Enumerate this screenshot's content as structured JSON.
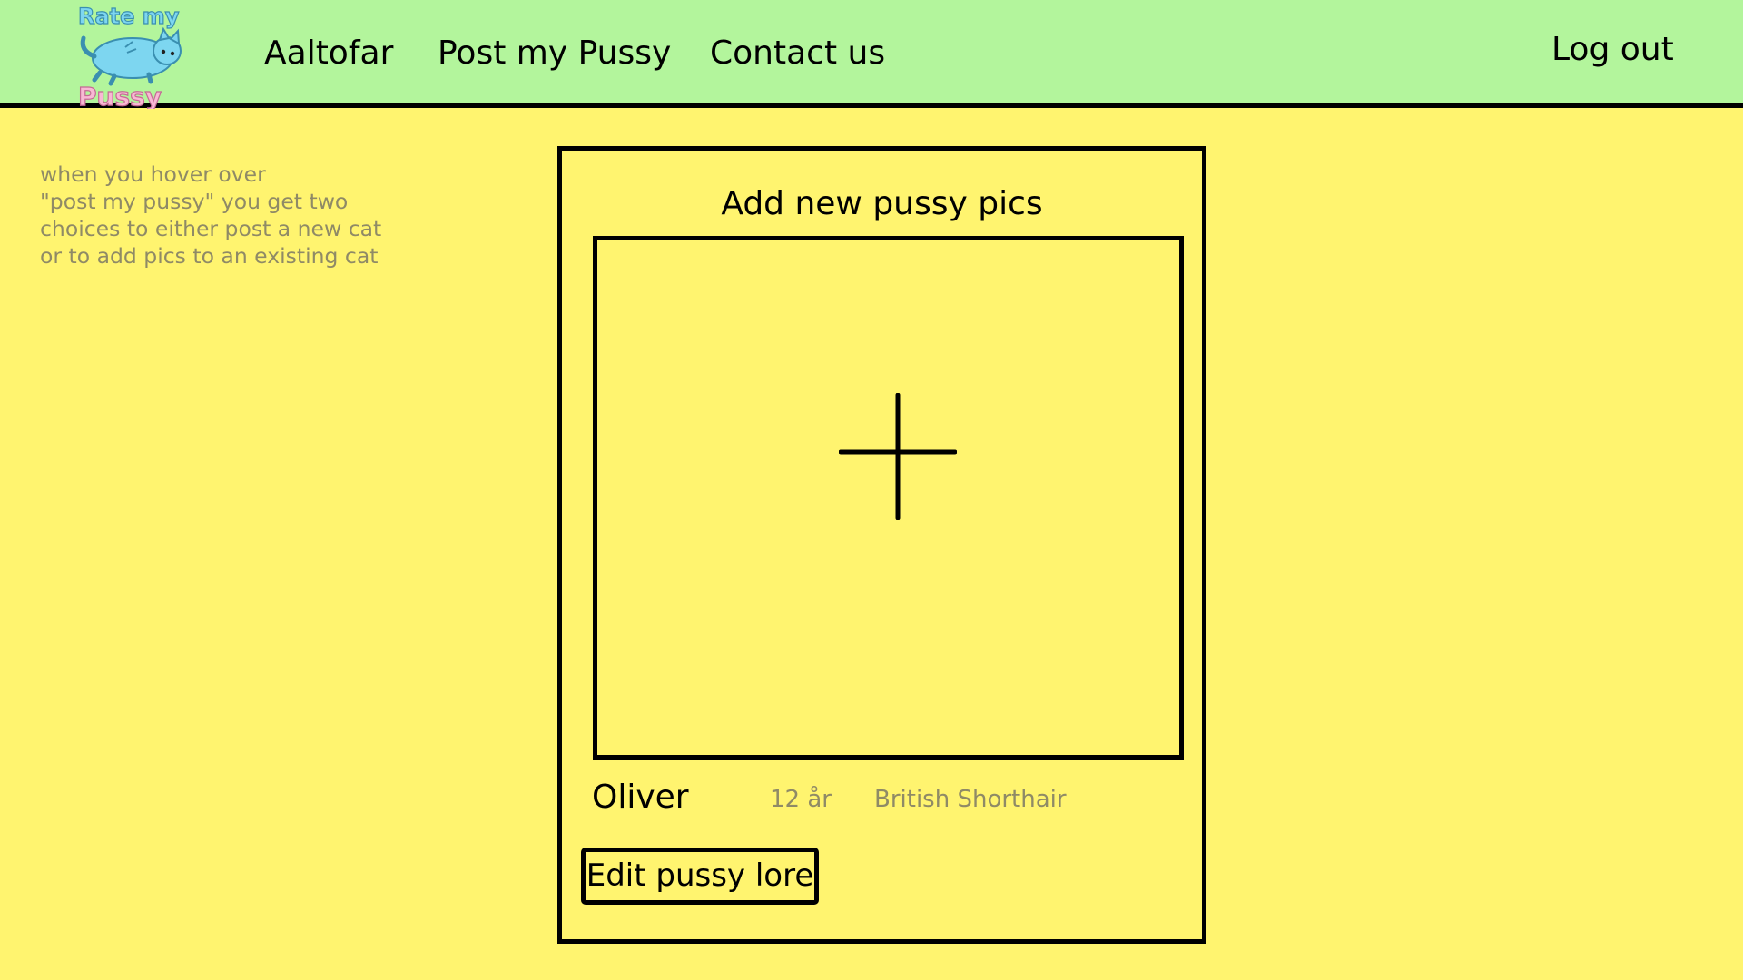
{
  "header": {
    "logo": {
      "text_top": "Rate my",
      "text_bottom": "Pussy",
      "colors": {
        "blue": "#7dd6f0",
        "pink": "#f8b9d4"
      }
    },
    "nav": {
      "aaltofar": "Aaltofar",
      "post_my_pussy": "Post my Pussy",
      "contact_us": "Contact us",
      "log_out": "Log out"
    }
  },
  "note": {
    "lines": [
      "when you hover over",
      "\"post my pussy\" you get two",
      "choices to either post a new cat",
      "or to add pics to an existing cat"
    ]
  },
  "card": {
    "title": "Add new pussy pics",
    "upload_icon": "plus-icon",
    "cat": {
      "name": "Oliver",
      "age": "12 år",
      "breed": "British Shorthair"
    },
    "edit_button": "Edit pussy lore"
  },
  "colors": {
    "header_bg": "#b3f59c",
    "page_bg": "#fff46f",
    "muted_text": "#8f8a66"
  }
}
